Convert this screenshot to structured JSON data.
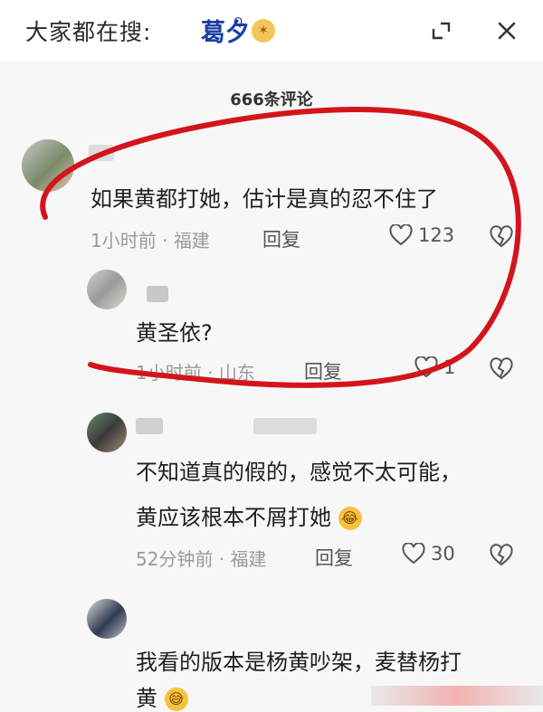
{
  "header": {
    "search_prefix": "大家都在搜:",
    "search_term": "葛夕",
    "search_sup": "Q",
    "comment_count": "666条评论"
  },
  "comments": [
    {
      "text": "如果黄都打她，估计是真的忍不住了",
      "time": "1小时前",
      "sep": "·",
      "location": "福建",
      "reply": "回复",
      "likes": "123"
    },
    {
      "text": "黄圣依?",
      "time": "1小时前",
      "sep": "·",
      "location": "山东",
      "reply": "回复",
      "likes": "1"
    },
    {
      "line1": "不知道真的假的，感觉不太可能，",
      "line2": "黄应该根本不屑打她",
      "time": "52分钟前",
      "sep": "·",
      "location": "福建",
      "reply": "回复",
      "likes": "30"
    },
    {
      "line1": "我看的版本是杨黄吵架，麦替杨打",
      "line2": "黄"
    }
  ],
  "icons": {
    "badge": "sparkle-emoji",
    "minimize": "minimize-icon",
    "close": "close-icon",
    "heart": "heart-icon",
    "dislike": "broken-heart-icon",
    "emoji_laugh": "laughing-tears-emoji",
    "emoji_sweat": "sweat-smile-emoji"
  },
  "colors": {
    "search_term": "#1a3fa0",
    "highlight_stroke": "#d4141c",
    "meta_text": "#9a9a9a"
  }
}
